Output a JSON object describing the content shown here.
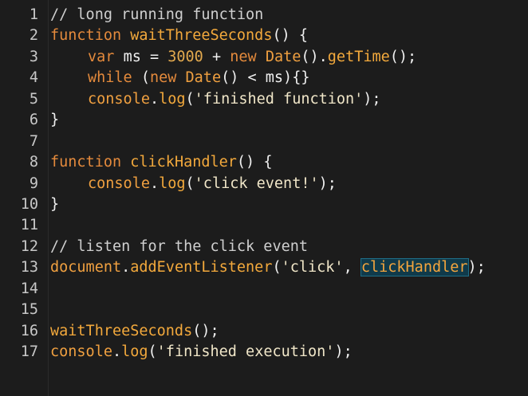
{
  "editor": {
    "lines": [
      {
        "n": "1",
        "indent": false,
        "tokens": [
          {
            "t": "// long running function",
            "c": "cm"
          }
        ]
      },
      {
        "n": "2",
        "indent": false,
        "tokens": [
          {
            "t": "function ",
            "c": "kw"
          },
          {
            "t": "waitThreeSeconds",
            "c": "fn"
          },
          {
            "t": "() {",
            "c": "br"
          }
        ]
      },
      {
        "n": "3",
        "indent": true,
        "tokens": [
          {
            "t": "var ",
            "c": "kw"
          },
          {
            "t": "ms = ",
            "c": "tx"
          },
          {
            "t": "3000",
            "c": "num"
          },
          {
            "t": " + ",
            "c": "tx"
          },
          {
            "t": "new ",
            "c": "kw"
          },
          {
            "t": "Date",
            "c": "cls"
          },
          {
            "t": "().",
            "c": "tx"
          },
          {
            "t": "getTime",
            "c": "fn"
          },
          {
            "t": "();",
            "c": "tx"
          }
        ]
      },
      {
        "n": "4",
        "indent": true,
        "tokens": [
          {
            "t": "while ",
            "c": "kw"
          },
          {
            "t": "(",
            "c": "tx"
          },
          {
            "t": "new ",
            "c": "kw"
          },
          {
            "t": "Date",
            "c": "cls"
          },
          {
            "t": "() < ms){}",
            "c": "tx"
          }
        ]
      },
      {
        "n": "5",
        "indent": true,
        "tokens": [
          {
            "t": "console",
            "c": "cls"
          },
          {
            "t": ".",
            "c": "tx"
          },
          {
            "t": "log",
            "c": "fn"
          },
          {
            "t": "(",
            "c": "tx"
          },
          {
            "t": "'finished function'",
            "c": "str"
          },
          {
            "t": ");",
            "c": "tx"
          }
        ]
      },
      {
        "n": "6",
        "indent": false,
        "tokens": [
          {
            "t": "}",
            "c": "br"
          }
        ]
      },
      {
        "n": "7",
        "indent": false,
        "tokens": []
      },
      {
        "n": "8",
        "indent": false,
        "tokens": [
          {
            "t": "function ",
            "c": "kw"
          },
          {
            "t": "clickHandler",
            "c": "fn"
          },
          {
            "t": "() {",
            "c": "br"
          }
        ]
      },
      {
        "n": "9",
        "indent": true,
        "tokens": [
          {
            "t": "console",
            "c": "cls"
          },
          {
            "t": ".",
            "c": "tx"
          },
          {
            "t": "log",
            "c": "fn"
          },
          {
            "t": "(",
            "c": "tx"
          },
          {
            "t": "'click event!'",
            "c": "str"
          },
          {
            "t": ");",
            "c": "tx"
          }
        ]
      },
      {
        "n": "10",
        "indent": false,
        "tokens": [
          {
            "t": "}",
            "c": "br"
          }
        ]
      },
      {
        "n": "11",
        "indent": false,
        "tokens": []
      },
      {
        "n": "12",
        "indent": false,
        "tokens": [
          {
            "t": "// listen for the click event",
            "c": "cm"
          }
        ]
      },
      {
        "n": "13",
        "indent": false,
        "tokens": [
          {
            "t": "document",
            "c": "cls"
          },
          {
            "t": ".",
            "c": "tx"
          },
          {
            "t": "addEventListener",
            "c": "fn"
          },
          {
            "t": "(",
            "c": "tx"
          },
          {
            "t": "'click'",
            "c": "str"
          },
          {
            "t": ", ",
            "c": "tx"
          },
          {
            "t": "clickHandler",
            "c": "sel"
          },
          {
            "t": ");",
            "c": "tx"
          }
        ]
      },
      {
        "n": "14",
        "indent": false,
        "tokens": []
      },
      {
        "n": "15",
        "indent": false,
        "tokens": []
      },
      {
        "n": "16",
        "indent": false,
        "tokens": [
          {
            "t": "waitThreeSeconds",
            "c": "fn"
          },
          {
            "t": "();",
            "c": "tx"
          }
        ]
      },
      {
        "n": "17",
        "indent": false,
        "tokens": [
          {
            "t": "console",
            "c": "cls"
          },
          {
            "t": ".",
            "c": "tx"
          },
          {
            "t": "log",
            "c": "fn"
          },
          {
            "t": "(",
            "c": "tx"
          },
          {
            "t": "'finished execution'",
            "c": "str"
          },
          {
            "t": ");",
            "c": "tx"
          }
        ]
      }
    ],
    "colors": {
      "background": "#1c1c1c",
      "keyword": "#e48a3c",
      "function": "#f3a93c",
      "selection": "#103a4a"
    }
  }
}
